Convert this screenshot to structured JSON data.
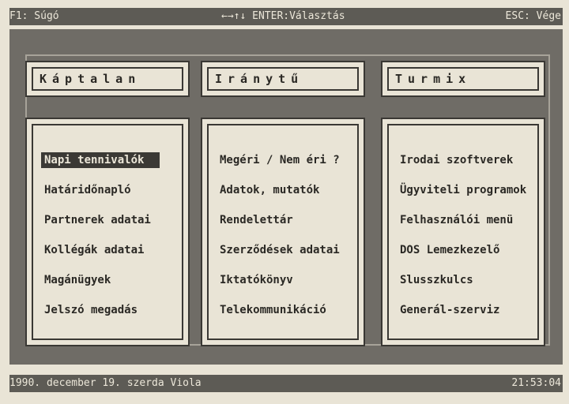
{
  "topbar": {
    "help": "F1: Súgó",
    "nav": "←→↑↓ ENTER:Választás",
    "exit": "ESC: Vége"
  },
  "columns": [
    {
      "title": "Káptalan",
      "items": [
        "Napi tennivalók",
        "Határidőnapló",
        "Partnerek adatai",
        "Kollégák adatai",
        "Magánügyek",
        "Jelszó megadás"
      ]
    },
    {
      "title": "Iránytű",
      "items": [
        "Megéri / Nem éri ?",
        "Adatok, mutatók",
        "Rendelettár",
        "Szerződések adatai",
        "Iktatókönyv",
        "Telekommunikáció"
      ]
    },
    {
      "title": "Turmix",
      "items": [
        "Irodai szoftverek",
        "Ügyviteli programok",
        "Felhasználói menü",
        "DOS Lemezkezelő",
        "Slusszkulcs",
        "Generál-szerviz"
      ]
    }
  ],
  "selected": "Napi tennivalók",
  "statusbar": {
    "date": "1990. december 19. szerda Viola",
    "time": "21:53:04"
  }
}
